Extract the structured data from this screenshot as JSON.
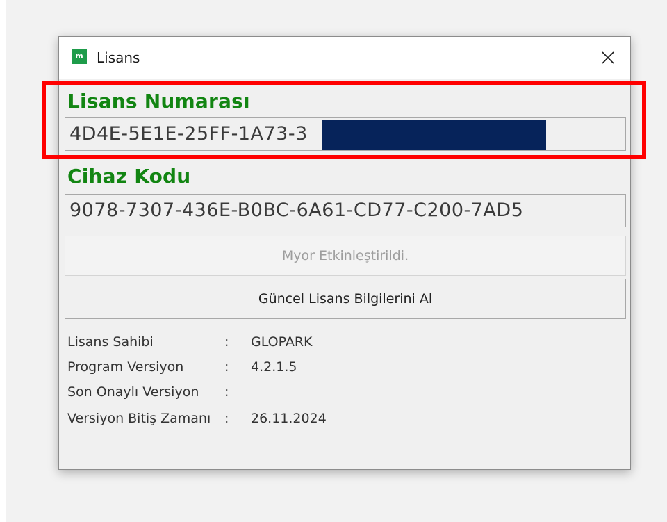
{
  "window": {
    "title": "Lisans",
    "icon": "app-logo-icon",
    "icon_glyph": "m",
    "close_glyph": "✕"
  },
  "license": {
    "heading": "Lisans Numarası",
    "value": "4D4E-5E1E-25FF-1A73-3"
  },
  "device": {
    "heading": "Cihaz Kodu",
    "value": "9078-7307-436E-B0BC-6A61-CD77-C200-7AD5"
  },
  "buttons": {
    "activate_label": "Myor Etkinleştirildi.",
    "refresh_label": "Güncel Lisans Bilgilerini Al"
  },
  "info": [
    {
      "label": "Lisans Sahibi",
      "colon": ":",
      "value": "GLOPARK"
    },
    {
      "label": "Program Versiyon",
      "colon": ":",
      "value": "4.2.1.5"
    },
    {
      "label": "Son Onaylı Versiyon",
      "colon": ":",
      "value": ""
    },
    {
      "label": "Versiyon Bitiş Zamanı",
      "colon": ":",
      "value": "26.11.2024"
    }
  ],
  "colors": {
    "heading_green": "#128512",
    "app_icon_green": "#1e9c4a",
    "highlight_red": "#ff0000",
    "redaction_navy": "#06235a"
  }
}
